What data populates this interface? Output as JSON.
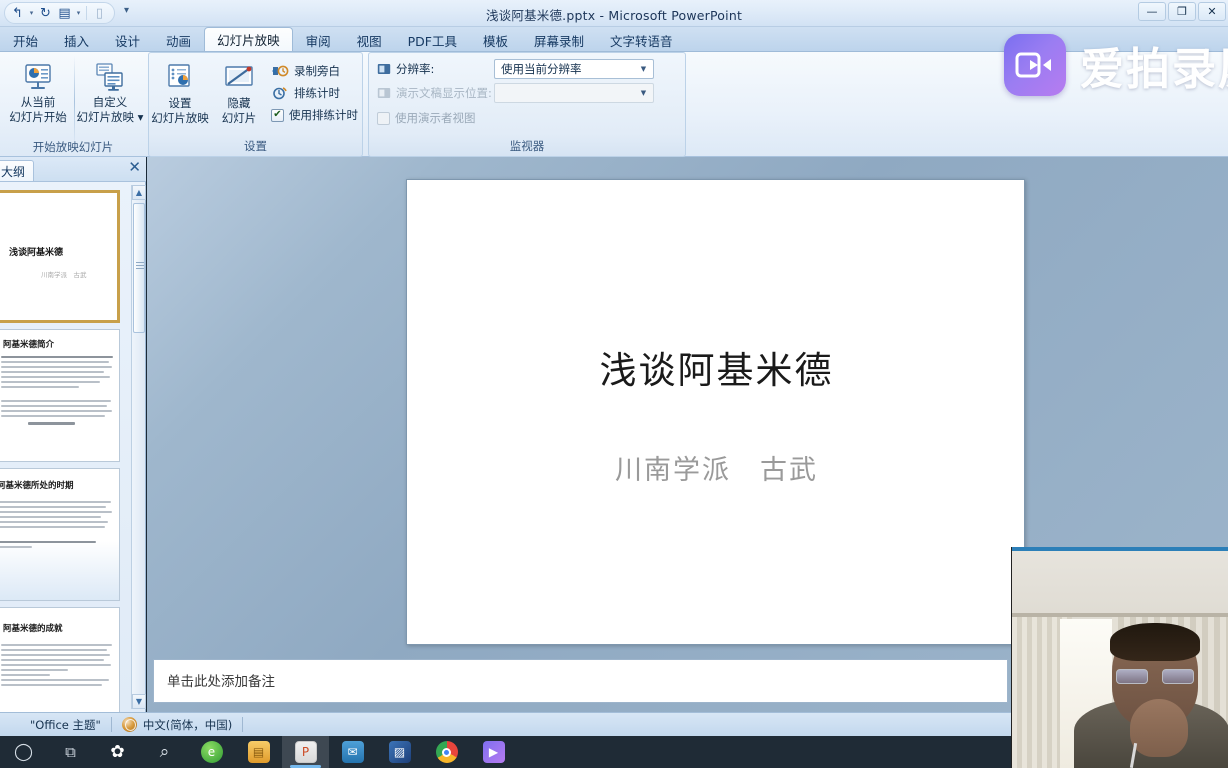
{
  "window": {
    "title": "浅谈阿基米德.pptx - Microsoft PowerPoint",
    "quick_access": [
      {
        "name": "undo-icon",
        "glyph": "↰"
      },
      {
        "name": "redo-icon",
        "glyph": "↻"
      },
      {
        "name": "save-icon",
        "glyph": "▤"
      },
      {
        "name": "new-icon",
        "glyph": "▯"
      },
      {
        "name": "customize-qat-icon",
        "glyph": "▾"
      }
    ],
    "controls": {
      "minimize": "—",
      "maximize": "❐",
      "close": "✕"
    }
  },
  "ribbon": {
    "tabs": [
      {
        "label": "开始",
        "active": false
      },
      {
        "label": "插入",
        "active": false
      },
      {
        "label": "设计",
        "active": false
      },
      {
        "label": "动画",
        "active": false
      },
      {
        "label": "幻灯片放映",
        "active": true
      },
      {
        "label": "审阅",
        "active": false
      },
      {
        "label": "视图",
        "active": false
      },
      {
        "label": "PDF工具",
        "active": false
      },
      {
        "label": "模板",
        "active": false
      },
      {
        "label": "屏幕录制",
        "active": false
      },
      {
        "label": "文字转语音",
        "active": false
      }
    ],
    "groups": {
      "start_show": {
        "label": "开始放映幻灯片",
        "buttons": [
          {
            "name": "from-current-slide-button",
            "line1": "从当前",
            "line2": "幻灯片开始"
          },
          {
            "name": "custom-slide-show-button",
            "line1": "自定义",
            "line2": "幻灯片放映 ▾"
          }
        ]
      },
      "setup": {
        "label": "设置",
        "buttons": [
          {
            "name": "set-up-slide-show-button",
            "line1": "设置",
            "line2": "幻灯片放映"
          },
          {
            "name": "hide-slide-button",
            "line1": "隐藏",
            "line2": "幻灯片"
          }
        ],
        "options": [
          {
            "name": "record-narration-option",
            "label": "录制旁白",
            "type": "command",
            "checked": false
          },
          {
            "name": "rehearse-timings-option",
            "label": "排练计时",
            "type": "command",
            "checked": false
          },
          {
            "name": "use-rehearsed-timings-checkbox",
            "label": "使用排练计时",
            "type": "checkbox",
            "checked": true
          }
        ]
      },
      "monitors": {
        "label": "监视器",
        "resolution_label": "分辨率:",
        "resolution_value": "使用当前分辨率",
        "show_on_label": "演示文稿显示位置:",
        "show_on_value": "",
        "presenter_view_label": "使用演示者视图",
        "presenter_view_checked": false
      }
    }
  },
  "slide_pane": {
    "tab_label": "大纲",
    "close_label": "✕",
    "thumbnails": [
      {
        "name": "slide-thumbnail-1",
        "title": "浅谈阿基米德",
        "subtitle": "川南学派　古武",
        "selected": true,
        "body_lines": 0
      },
      {
        "name": "slide-thumbnail-2",
        "title": "阿基米德简介",
        "subtitle": "",
        "selected": false,
        "body_lines": 13
      },
      {
        "name": "slide-thumbnail-3",
        "title": "阿基米德所处的时期",
        "subtitle": "",
        "selected": false,
        "body_lines": 10
      },
      {
        "name": "slide-thumbnail-4",
        "title": "阿基米德的成就",
        "subtitle": "",
        "selected": false,
        "body_lines": 12
      }
    ]
  },
  "slide": {
    "title": "浅谈阿基米德",
    "subtitle": "川南学派　古武"
  },
  "notes": {
    "placeholder": "单击此处添加备注"
  },
  "status_bar": {
    "theme": "\"Office 主题\"",
    "language": "中文(简体，中国)",
    "globe_icon": "language-globe-icon"
  },
  "taskbar": {
    "items": [
      {
        "name": "start-button",
        "glyph": "◯",
        "color": "#cfd8e0",
        "bg": "transparent",
        "active": false
      },
      {
        "name": "task-view-button",
        "glyph": "⧉",
        "color": "#cfd8e0",
        "bg": "transparent",
        "active": false
      },
      {
        "name": "taskbar-app-pinwheel",
        "glyph": "✿",
        "color": "#ffffff",
        "bg": "transparent",
        "active": false
      },
      {
        "name": "search-everything-icon",
        "glyph": "⌕",
        "color": "#d7e0e8",
        "bg": "transparent",
        "active": false
      },
      {
        "name": "browser-360-icon",
        "glyph": "e",
        "color": "#ffffff",
        "bg": "#3fae3f",
        "active": false
      },
      {
        "name": "file-explorer-icon",
        "glyph": "▤",
        "color": "#f6c352",
        "bg": "#e8a62e",
        "active": false
      },
      {
        "name": "powerpoint-icon",
        "glyph": "P",
        "color": "#ffffff",
        "bg": "#d14524",
        "active": true
      },
      {
        "name": "outlook-icon",
        "glyph": "✉",
        "color": "#ffffff",
        "bg": "#2a7fc0",
        "active": false
      },
      {
        "name": "photo-viewer-icon",
        "glyph": "▨",
        "color": "#ffffff",
        "bg": "#2d5c9e",
        "active": false
      },
      {
        "name": "chrome-icon",
        "glyph": "◉",
        "color": "#ffffff",
        "bg": "#e8453c",
        "active": false
      },
      {
        "name": "aipai-recorder-icon",
        "glyph": "▶",
        "color": "#ffffff",
        "bg": "#8a6ef0",
        "active": false
      }
    ],
    "tray": [
      {
        "name": "tray-expand-icon",
        "glyph": "︿"
      },
      {
        "name": "microphone-icon",
        "glyph": "🎙"
      },
      {
        "name": "shield-icon",
        "glyph": "◉"
      },
      {
        "name": "volume-icon",
        "glyph": "🔊"
      }
    ]
  },
  "overlay": {
    "watermark_text": "爱拍录屏",
    "watermark_icon": "aipai-recorder-logo-icon",
    "webcam_name": "webcam-overlay"
  }
}
